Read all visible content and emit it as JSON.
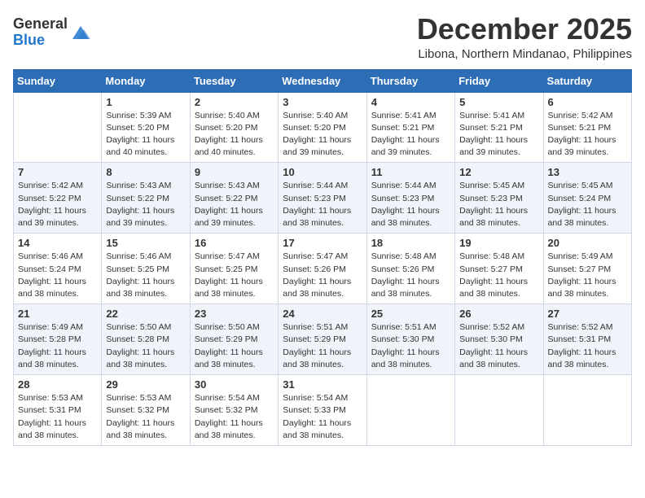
{
  "logo": {
    "general": "General",
    "blue": "Blue"
  },
  "title": {
    "month": "December 2025",
    "location": "Libona, Northern Mindanao, Philippines"
  },
  "headers": [
    "Sunday",
    "Monday",
    "Tuesday",
    "Wednesday",
    "Thursday",
    "Friday",
    "Saturday"
  ],
  "weeks": [
    [
      {
        "day": "",
        "sunrise": "",
        "sunset": "",
        "daylight": ""
      },
      {
        "day": "1",
        "sunrise": "Sunrise: 5:39 AM",
        "sunset": "Sunset: 5:20 PM",
        "daylight": "Daylight: 11 hours and 40 minutes."
      },
      {
        "day": "2",
        "sunrise": "Sunrise: 5:40 AM",
        "sunset": "Sunset: 5:20 PM",
        "daylight": "Daylight: 11 hours and 40 minutes."
      },
      {
        "day": "3",
        "sunrise": "Sunrise: 5:40 AM",
        "sunset": "Sunset: 5:20 PM",
        "daylight": "Daylight: 11 hours and 39 minutes."
      },
      {
        "day": "4",
        "sunrise": "Sunrise: 5:41 AM",
        "sunset": "Sunset: 5:21 PM",
        "daylight": "Daylight: 11 hours and 39 minutes."
      },
      {
        "day": "5",
        "sunrise": "Sunrise: 5:41 AM",
        "sunset": "Sunset: 5:21 PM",
        "daylight": "Daylight: 11 hours and 39 minutes."
      },
      {
        "day": "6",
        "sunrise": "Sunrise: 5:42 AM",
        "sunset": "Sunset: 5:21 PM",
        "daylight": "Daylight: 11 hours and 39 minutes."
      }
    ],
    [
      {
        "day": "7",
        "sunrise": "Sunrise: 5:42 AM",
        "sunset": "Sunset: 5:22 PM",
        "daylight": "Daylight: 11 hours and 39 minutes."
      },
      {
        "day": "8",
        "sunrise": "Sunrise: 5:43 AM",
        "sunset": "Sunset: 5:22 PM",
        "daylight": "Daylight: 11 hours and 39 minutes."
      },
      {
        "day": "9",
        "sunrise": "Sunrise: 5:43 AM",
        "sunset": "Sunset: 5:22 PM",
        "daylight": "Daylight: 11 hours and 39 minutes."
      },
      {
        "day": "10",
        "sunrise": "Sunrise: 5:44 AM",
        "sunset": "Sunset: 5:23 PM",
        "daylight": "Daylight: 11 hours and 38 minutes."
      },
      {
        "day": "11",
        "sunrise": "Sunrise: 5:44 AM",
        "sunset": "Sunset: 5:23 PM",
        "daylight": "Daylight: 11 hours and 38 minutes."
      },
      {
        "day": "12",
        "sunrise": "Sunrise: 5:45 AM",
        "sunset": "Sunset: 5:23 PM",
        "daylight": "Daylight: 11 hours and 38 minutes."
      },
      {
        "day": "13",
        "sunrise": "Sunrise: 5:45 AM",
        "sunset": "Sunset: 5:24 PM",
        "daylight": "Daylight: 11 hours and 38 minutes."
      }
    ],
    [
      {
        "day": "14",
        "sunrise": "Sunrise: 5:46 AM",
        "sunset": "Sunset: 5:24 PM",
        "daylight": "Daylight: 11 hours and 38 minutes."
      },
      {
        "day": "15",
        "sunrise": "Sunrise: 5:46 AM",
        "sunset": "Sunset: 5:25 PM",
        "daylight": "Daylight: 11 hours and 38 minutes."
      },
      {
        "day": "16",
        "sunrise": "Sunrise: 5:47 AM",
        "sunset": "Sunset: 5:25 PM",
        "daylight": "Daylight: 11 hours and 38 minutes."
      },
      {
        "day": "17",
        "sunrise": "Sunrise: 5:47 AM",
        "sunset": "Sunset: 5:26 PM",
        "daylight": "Daylight: 11 hours and 38 minutes."
      },
      {
        "day": "18",
        "sunrise": "Sunrise: 5:48 AM",
        "sunset": "Sunset: 5:26 PM",
        "daylight": "Daylight: 11 hours and 38 minutes."
      },
      {
        "day": "19",
        "sunrise": "Sunrise: 5:48 AM",
        "sunset": "Sunset: 5:27 PM",
        "daylight": "Daylight: 11 hours and 38 minutes."
      },
      {
        "day": "20",
        "sunrise": "Sunrise: 5:49 AM",
        "sunset": "Sunset: 5:27 PM",
        "daylight": "Daylight: 11 hours and 38 minutes."
      }
    ],
    [
      {
        "day": "21",
        "sunrise": "Sunrise: 5:49 AM",
        "sunset": "Sunset: 5:28 PM",
        "daylight": "Daylight: 11 hours and 38 minutes."
      },
      {
        "day": "22",
        "sunrise": "Sunrise: 5:50 AM",
        "sunset": "Sunset: 5:28 PM",
        "daylight": "Daylight: 11 hours and 38 minutes."
      },
      {
        "day": "23",
        "sunrise": "Sunrise: 5:50 AM",
        "sunset": "Sunset: 5:29 PM",
        "daylight": "Daylight: 11 hours and 38 minutes."
      },
      {
        "day": "24",
        "sunrise": "Sunrise: 5:51 AM",
        "sunset": "Sunset: 5:29 PM",
        "daylight": "Daylight: 11 hours and 38 minutes."
      },
      {
        "day": "25",
        "sunrise": "Sunrise: 5:51 AM",
        "sunset": "Sunset: 5:30 PM",
        "daylight": "Daylight: 11 hours and 38 minutes."
      },
      {
        "day": "26",
        "sunrise": "Sunrise: 5:52 AM",
        "sunset": "Sunset: 5:30 PM",
        "daylight": "Daylight: 11 hours and 38 minutes."
      },
      {
        "day": "27",
        "sunrise": "Sunrise: 5:52 AM",
        "sunset": "Sunset: 5:31 PM",
        "daylight": "Daylight: 11 hours and 38 minutes."
      }
    ],
    [
      {
        "day": "28",
        "sunrise": "Sunrise: 5:53 AM",
        "sunset": "Sunset: 5:31 PM",
        "daylight": "Daylight: 11 hours and 38 minutes."
      },
      {
        "day": "29",
        "sunrise": "Sunrise: 5:53 AM",
        "sunset": "Sunset: 5:32 PM",
        "daylight": "Daylight: 11 hours and 38 minutes."
      },
      {
        "day": "30",
        "sunrise": "Sunrise: 5:54 AM",
        "sunset": "Sunset: 5:32 PM",
        "daylight": "Daylight: 11 hours and 38 minutes."
      },
      {
        "day": "31",
        "sunrise": "Sunrise: 5:54 AM",
        "sunset": "Sunset: 5:33 PM",
        "daylight": "Daylight: 11 hours and 38 minutes."
      },
      {
        "day": "",
        "sunrise": "",
        "sunset": "",
        "daylight": ""
      },
      {
        "day": "",
        "sunrise": "",
        "sunset": "",
        "daylight": ""
      },
      {
        "day": "",
        "sunrise": "",
        "sunset": "",
        "daylight": ""
      }
    ]
  ]
}
